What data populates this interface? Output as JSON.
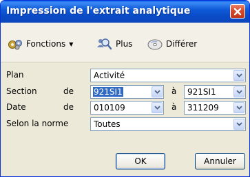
{
  "window": {
    "title": "Impression de l'extrait analytique"
  },
  "toolbar": {
    "functions_label": "Fonctions",
    "plus_label": "Plus",
    "differ_label": "Différer"
  },
  "form": {
    "plan_label": "Plan",
    "plan_value": "Activité",
    "section_label": "Section",
    "section_from_label": "de",
    "section_from_value": "921SI1",
    "section_to_label": "à",
    "section_to_value": "921SI1",
    "date_label": "Date",
    "date_from_label": "de",
    "date_from_value": "010109",
    "date_to_label": "à",
    "date_to_value": "311209",
    "norm_label": "Selon la norme",
    "norm_value": "Toutes"
  },
  "buttons": {
    "ok_label": "OK",
    "cancel_label": "Annuler"
  },
  "icons": {
    "functions": "gears-icon",
    "plus": "magnifier-people-icon",
    "differ": "cd-icon",
    "close": "close-icon",
    "dropdown": "chevron-down-icon"
  },
  "colors": {
    "titlebar": "#0a4bc6",
    "close": "#d6492c",
    "selection": "#316ac5"
  }
}
